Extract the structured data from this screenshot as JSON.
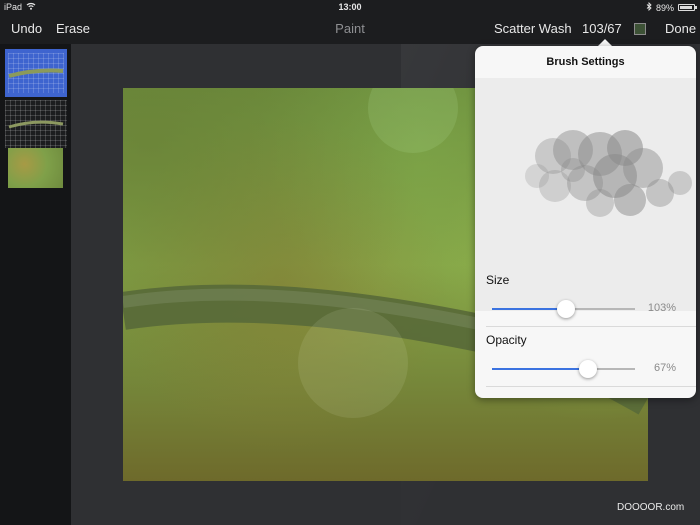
{
  "status_bar": {
    "device": "iPad",
    "time": "13:00",
    "battery_percent": "89%",
    "battery_level": 0.89
  },
  "toolbar": {
    "undo_label": "Undo",
    "erase_label": "Erase",
    "title": "Paint",
    "brush_name": "Scatter Wash",
    "brush_values": "103/67",
    "current_color": "#3d5236",
    "done_label": "Done"
  },
  "layers": {
    "count": 3,
    "selected_index": 0
  },
  "brush_settings": {
    "title": "Brush Settings",
    "size": {
      "label": "Size",
      "value": "103%",
      "level": 0.515
    },
    "opacity": {
      "label": "Opacity",
      "value": "67%",
      "level": 0.67
    }
  },
  "watermark": "DOOOOR.com",
  "colors": {
    "accent": "#3b73e0",
    "selected_layer": "#3e64cf"
  }
}
